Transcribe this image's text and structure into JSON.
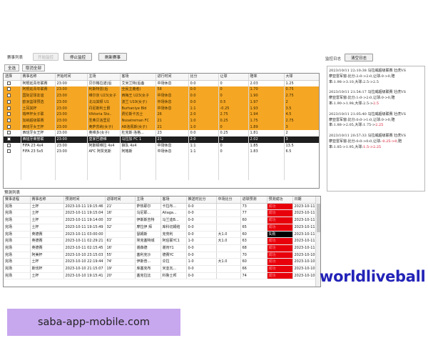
{
  "events_panel": {
    "title": "赛事列表",
    "buttons": {
      "start_monitor": "开始监控",
      "stop_monitor": "停止监控",
      "refresh_events": "刷新赛事"
    },
    "select_all": "全选",
    "deselect_all": "取消全部",
    "columns": [
      "选择",
      "赛事名称",
      "开始时间",
      "主场",
      "客场",
      "进行时间",
      "比分",
      "让球",
      "赔率",
      "大球"
    ],
    "rows": [
      {
        "style": "white",
        "name": "阿根廷青年联赛",
        "time": "23:00",
        "home": "贝尔格拉诺(后",
        "away": "艾米兰特(后备",
        "elapsed": "中场休息",
        "score": "0:0",
        "handicap": "0",
        "odds": "2.03",
        "over": "1.25"
      },
      {
        "style": "orange",
        "name": "阿根廷青年联赛",
        "time": "23:00",
        "home": "利斯特雷(后",
        "away": "全民主義者(",
        "elapsed": "58",
        "score": "0:0",
        "handicap": "0",
        "odds": "1.70",
        "over": "0.75"
      },
      {
        "style": "orange",
        "name": "国际足球友谊",
        "time": "23:00",
        "home": "维尔京 U23(女子",
        "away": "西梅王 U23(女子",
        "elapsed": "中场休息",
        "score": "0:0",
        "handicap": "0",
        "odds": "1.90",
        "over": "2.75"
      },
      {
        "style": "orange",
        "name": "欧洲篮球预选",
        "time": "23:00",
        "home": "北马其顿 U1",
        "away": "波兰 U19(女子)",
        "elapsed": "中场休息",
        "score": "0:0",
        "handicap": "0.5",
        "odds": "1.97",
        "over": "2"
      },
      {
        "style": "orange",
        "name": "土耳其杯",
        "time": "23:00",
        "home": "丹尼斯利士爵",
        "away": "Burhaniye Bld",
        "elapsed": "中场休息",
        "score": "1:1",
        "handicap": "-0.25",
        "odds": "1.93",
        "over": "3.5"
      },
      {
        "style": "orange",
        "name": "瑞甲杯女子联",
        "time": "23:00",
        "home": "Viktoria Sto..",
        "away": "费伦斯卡瓦士",
        "elapsed": "26",
        "score": "2:0",
        "handicap": "2.75",
        "odds": "1.94",
        "over": "4.5"
      },
      {
        "style": "orange",
        "name": "加纳超级联赛",
        "time": "23:00",
        "home": "圣弗贝洛里尼",
        "away": "Nsoatreman FC",
        "elapsed": "21",
        "odds": "1.75",
        "score": "1:0",
        "handicap": "0.25",
        "over": "2.75"
      },
      {
        "style": "orange",
        "name": "西班牙女王杯",
        "time": "23:00",
        "home": "奥萨苏纳(女子)",
        "away": "AB洛佩斯(女子)",
        "elapsed": "21",
        "score": "1:0",
        "handicap": "0",
        "odds": "1.89",
        "over": "3"
      },
      {
        "style": "white",
        "name": "西班牙女王杯",
        "time": "23:00",
        "home": "奥维多(女子)",
        "away": "杜克斯·洛格...",
        "elapsed": "23",
        "score": "0:0",
        "handicap": "0.25",
        "odds": "1.81",
        "over": "2"
      },
      {
        "style": "selected",
        "name": "西班牙荣誉联",
        "time": "23:00",
        "home": "皇家巴德维",
        "away": "马拉加 FC 1",
        "elapsed": "21",
        "score": "2:0",
        "handicap": "-2",
        "odds": "2.02",
        "over": "3"
      },
      {
        "style": "white",
        "name": "FIFA 23 4x4",
        "time": "23:00",
        "home": "阿斯顿维拉 4x4",
        "away": "狼队 4x4",
        "elapsed": "中场休息",
        "score": "1:1",
        "handicap": "0",
        "odds": "1.85",
        "over": "13.5"
      },
      {
        "style": "white",
        "name": "FIFA 23 5x5",
        "time": "23:00",
        "home": "AFC 阿贾克斯",
        "away": "阿格斯",
        "elapsed": "中场休息",
        "score": "1:1",
        "handicap": "0",
        "odds": "1.83",
        "over": "6.5"
      }
    ]
  },
  "log_panel": {
    "title": "监控日志",
    "clear_button": "清空日志",
    "entries": [
      {
        "line1": "2023/10/11 22:10:38 马拉威超级联赛 壮虎VS",
        "line2": "摩亚雷军窗:比分:2:0->2:0,让球:0->0,赔",
        "line3": "率:1.98->3.10,大球:2.5->2.5",
        "highlight": ""
      },
      {
        "line1": "2023/10/11 21:54:17 马拉威超级联赛 壮虎VS",
        "line2": "摩亚雷军窗:比分:1:0->2:0,让球:0->0,赔",
        "line3": "率:1.90->1.98,大球:2.5->",
        "highlight": "2.5"
      },
      {
        "line1": "2023/10/11 21:05:40 马拉威超级联赛 壮虎VS",
        "line2": "摩亚雷军窗:比分:0:0->1:0,让球:0->0,赔",
        "line3": "率:1.88->2.05,大球:1.75->",
        "highlight": "2.25"
      },
      {
        "line1": "2023/10/11 20:57:33 马拉威超级联赛 壮虎VS",
        "line2": "摩亚雷军窗:比分:0:0->0:0,让球:",
        "line2_hl": "-0.25->0",
        "line2_end": ",赔",
        "line3": "率:1.85->1.95,大球:",
        "highlight": "1.5->2.25"
      }
    ]
  },
  "predictions_panel": {
    "title": "预测列表",
    "columns": [
      "赛事进程",
      "赛事名称",
      "预测时间",
      "进球时间",
      "主场",
      "客场",
      "推送时比分",
      "中场比分",
      "进球预测",
      "预测成功",
      "日期"
    ],
    "rows": [
      {
        "status": "完场",
        "name": "土杯",
        "pred_time": "2023-10-11 19:15:46",
        "goal_time": "21'",
        "home": "萨热耶尔",
        "away": "卡拉布...",
        "push_score": "0-0",
        "half_score": "",
        "goal_pred": "73",
        "success": "成功",
        "result": "red",
        "date": "2023-10-11"
      },
      {
        "status": "完场",
        "name": "土杯",
        "pred_time": "2023-10-11 19:15:04",
        "goal_time": "16'",
        "home": "乌尼耶...",
        "away": "Aliaga...",
        "push_score": "0-0",
        "half_score": "",
        "goal_pred": "77",
        "success": "成功",
        "result": "red",
        "date": "2023-10-11"
      },
      {
        "status": "完场",
        "name": "土杯",
        "pred_time": "2023-10-11 19:14:00",
        "goal_time": "33'",
        "home": "伊斯斯吉特",
        "away": "马兰迪B...",
        "push_score": "0-0",
        "half_score": "",
        "goal_pred": "60",
        "success": "成功",
        "result": "red",
        "date": "2023-10-11"
      },
      {
        "status": "完场",
        "name": "土杯",
        "pred_time": "2023-10-11 19:15:49",
        "goal_time": "32'",
        "home": "摩拉伊 拜",
        "away": "库科切姆结",
        "push_score": "0-0",
        "half_score": "",
        "goal_pred": "65",
        "success": "成功",
        "result": "red",
        "date": "2023-10-11"
      },
      {
        "status": "完场",
        "name": "英德赛",
        "pred_time": "2023-10-11 03:00:00",
        "goal_time": "",
        "home": "瑟姆斯",
        "away": "克劳利",
        "push_score": "0-0",
        "half_score": "大1.0",
        "goal_pred": "60",
        "success": "失败",
        "result": "black",
        "date": "2023-10-11"
      },
      {
        "status": "完场",
        "name": "英德赛",
        "pred_time": "2023-10-11 02:29:21",
        "goal_time": "61'",
        "home": "埃克塞特城",
        "away": "阿伯联YC1",
        "push_score": "1-0",
        "half_score": "大1.0",
        "goal_pred": "63",
        "success": "成功",
        "result": "red",
        "date": "2023-10-11"
      },
      {
        "status": "完场",
        "name": "英德赛",
        "pred_time": "2023-10-11 02:15:45",
        "goal_time": "16'",
        "home": "谢森德",
        "away": "谢肯Y1",
        "push_score": "0-0",
        "half_score": "",
        "goal_pred": "68",
        "success": "成功",
        "result": "red",
        "date": "2023-10-11"
      },
      {
        "status": "完场",
        "name": "阿美杯",
        "pred_time": "2023-10-10 23:15:03",
        "goal_time": "55'",
        "home": "塞利克沙",
        "away": "德赛YC",
        "push_score": "0-0",
        "half_score": "",
        "goal_pred": "70",
        "success": "成功",
        "result": "red",
        "date": "2023-10-10"
      },
      {
        "status": "完场",
        "name": "土杯",
        "pred_time": "2023-10-10 22:19:44",
        "goal_time": "74'",
        "home": "伊斯普...",
        "away": "伞拉",
        "push_score": "1-0",
        "half_score": "大1.0",
        "goal_pred": "60",
        "success": "成功",
        "result": "red",
        "date": "2023-10-10"
      },
      {
        "status": "完场",
        "name": "斯伐杯",
        "pred_time": "2023-10-10 21:15:07",
        "goal_time": "19'",
        "home": "库塞克布",
        "away": "米亚瓦...",
        "push_score": "0-0",
        "half_score": "",
        "goal_pred": "66",
        "success": "成功",
        "result": "red",
        "date": "2023-10-10"
      },
      {
        "status": "完场",
        "name": "土杯",
        "pred_time": "2023-10-10 19:15:41",
        "goal_time": "20'",
        "home": "塞克拉比",
        "away": "科鲁士邦",
        "push_score": "0-0",
        "half_score": "",
        "goal_pred": "74",
        "success": "成功",
        "result": "red",
        "date": "2023-10-10"
      }
    ]
  },
  "watermark": "worldliveball",
  "promo": "saba-app-mobile.com",
  "colors": {
    "row_orange": "#f5a623",
    "success_red": "#e8000b",
    "brand_blue": "#2323b8",
    "promo_bg": "#c7a7ee"
  }
}
